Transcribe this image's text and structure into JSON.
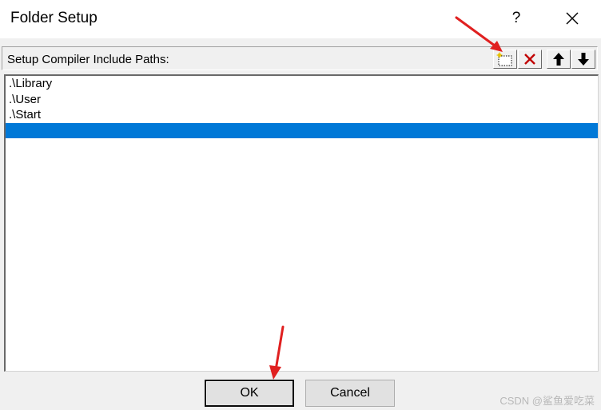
{
  "window": {
    "title": "Folder Setup",
    "help_label": "?",
    "close_icon": "close-icon"
  },
  "header": {
    "label": "Setup Compiler Include Paths:",
    "tools": [
      {
        "name": "new-folder-button",
        "icon": "new-folder-icon"
      },
      {
        "name": "delete-button",
        "icon": "delete-x-icon",
        "color": "#c00000"
      },
      {
        "name": "move-up-button",
        "icon": "arrow-up-icon"
      },
      {
        "name": "move-down-button",
        "icon": "arrow-down-icon"
      }
    ]
  },
  "paths": [
    ".\\Library",
    ".\\User",
    ".\\Start",
    ""
  ],
  "selected_index": 3,
  "buttons": {
    "ok_label": "OK",
    "cancel_label": "Cancel"
  },
  "watermark": "CSDN @鲨鱼爱吃菜",
  "colors": {
    "selection": "#0078d7",
    "annotation_arrow": "#e02020"
  }
}
